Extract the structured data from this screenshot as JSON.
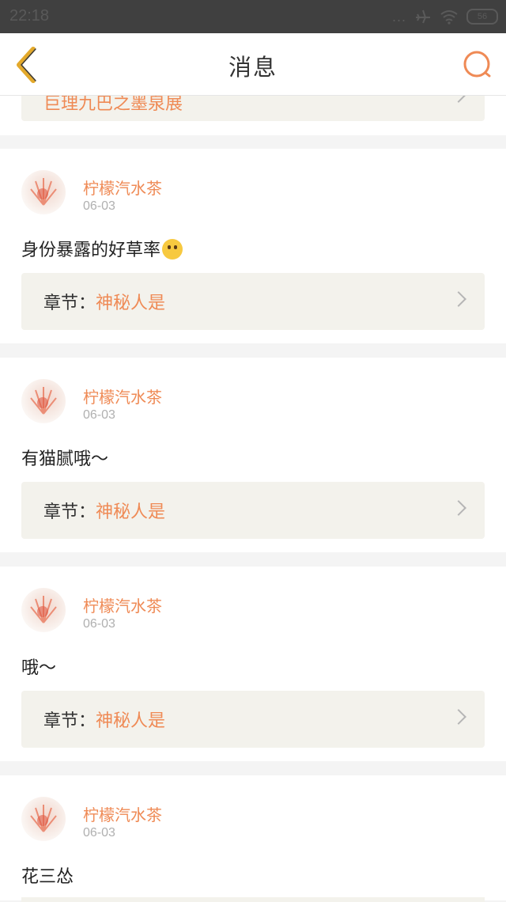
{
  "status_bar": {
    "time": "22:18",
    "dots": "...",
    "battery": "56"
  },
  "navbar": {
    "title": "消息"
  },
  "partial_top": {
    "chapter_text": "巨理九巴之墨泉展"
  },
  "messages": [
    {
      "username": "柠檬汽水茶",
      "date": "06-03",
      "content": "身份暴露的好草率",
      "has_emoji": true,
      "chapter_prefix": "章节：",
      "chapter_name": "神秘人是"
    },
    {
      "username": "柠檬汽水茶",
      "date": "06-03",
      "content": "有猫腻哦～",
      "has_emoji": false,
      "chapter_prefix": "章节：",
      "chapter_name": "神秘人是"
    },
    {
      "username": "柠檬汽水茶",
      "date": "06-03",
      "content": "哦～",
      "has_emoji": false,
      "chapter_prefix": "章节：",
      "chapter_name": "神秘人是"
    },
    {
      "username": "柠檬汽水茶",
      "date": "06-03",
      "content": "花三怂",
      "has_emoji": false
    }
  ],
  "colors": {
    "accent": "#ef8a55",
    "back_icon": "#e3a92b",
    "chapter_bg": "#f3f2ec"
  },
  "icons": {
    "back": "chevron-left-icon",
    "search": "search-icon",
    "chevron": "chevron-right-icon"
  }
}
